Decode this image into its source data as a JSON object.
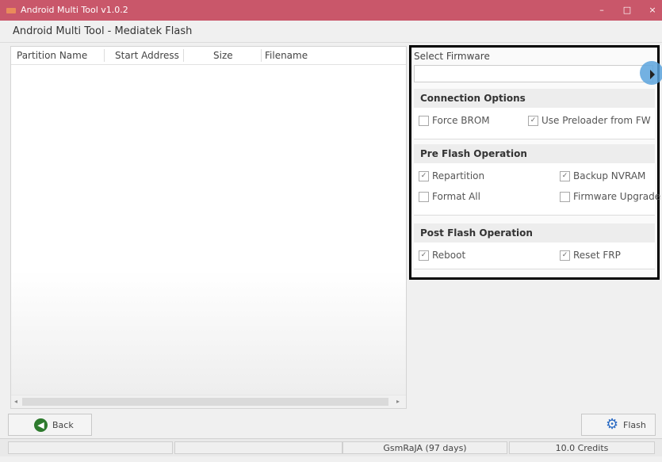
{
  "window": {
    "title": "Android Multi Tool v1.0.2",
    "minimize": "–",
    "maximize": "□",
    "close": "×"
  },
  "subtitle": "Android Multi Tool - Mediatek Flash",
  "table": {
    "columns": [
      "Partition Name",
      "Start Address",
      "Size",
      "Filename"
    ],
    "rows": []
  },
  "firmware": {
    "label": "Select Firmware",
    "value": ""
  },
  "connection_options": {
    "title": "Connection Options",
    "force_brom": {
      "label": "Force BROM",
      "checked": false
    },
    "use_preloader": {
      "label": "Use Preloader from FW",
      "checked": true
    }
  },
  "pre_flash": {
    "title": "Pre Flash Operation",
    "repartition": {
      "label": "Repartition",
      "checked": true
    },
    "backup_nvram": {
      "label": "Backup NVRAM",
      "checked": true
    },
    "format_all": {
      "label": "Format All",
      "checked": false
    },
    "firmware_upgrade": {
      "label": "Firmware Upgrade",
      "checked": false
    }
  },
  "post_flash": {
    "title": "Post Flash Operation",
    "reboot": {
      "label": "Reboot",
      "checked": true
    },
    "reset_frp": {
      "label": "Reset FRP",
      "checked": true
    }
  },
  "buttons": {
    "back": "Back",
    "flash": "Flash"
  },
  "status": {
    "user": "GsmRaJA (97 days)",
    "credits": "10.0 Credits"
  },
  "colors": {
    "titlebar": "#c9576a",
    "back_icon": "#2d7a2d",
    "flash_icon": "#2b6bc4"
  }
}
